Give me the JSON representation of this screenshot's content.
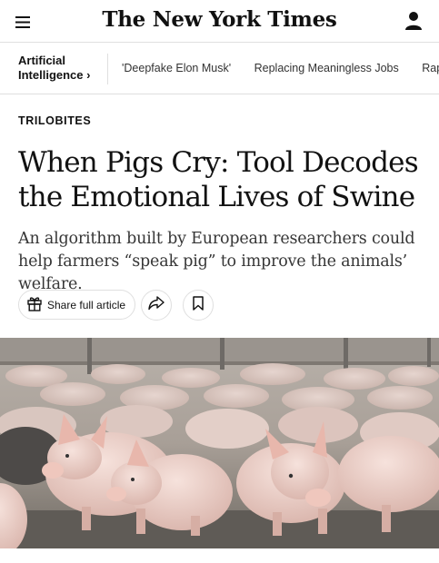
{
  "header": {
    "masthead": "The New York Times",
    "menu_icon": "hamburger-menu-icon",
    "account_icon": "user-account-icon"
  },
  "subnav": {
    "section_label": "Artificial Intelligence ›",
    "topics": [
      "'Deepfake Elon Musk'",
      "Replacing Meaningless Jobs",
      "Rapid"
    ]
  },
  "article": {
    "kicker": "TRILOBITES",
    "headline": "When Pigs Cry: Tool Decodes the Emotional Lives of Swine",
    "summary": "An algorithm built by European researchers could help farmers “speak pig” to improve the animals’ welfare.",
    "share_label": "Share full article",
    "share_icon": "gift-icon",
    "forward_icon": "share-arrow-icon",
    "bookmark_icon": "bookmark-icon"
  },
  "photo": {
    "subject": "piglets-in-pen"
  },
  "colors": {
    "text": "#121212",
    "summary_text": "#363636",
    "border": "#dfdfdf"
  }
}
